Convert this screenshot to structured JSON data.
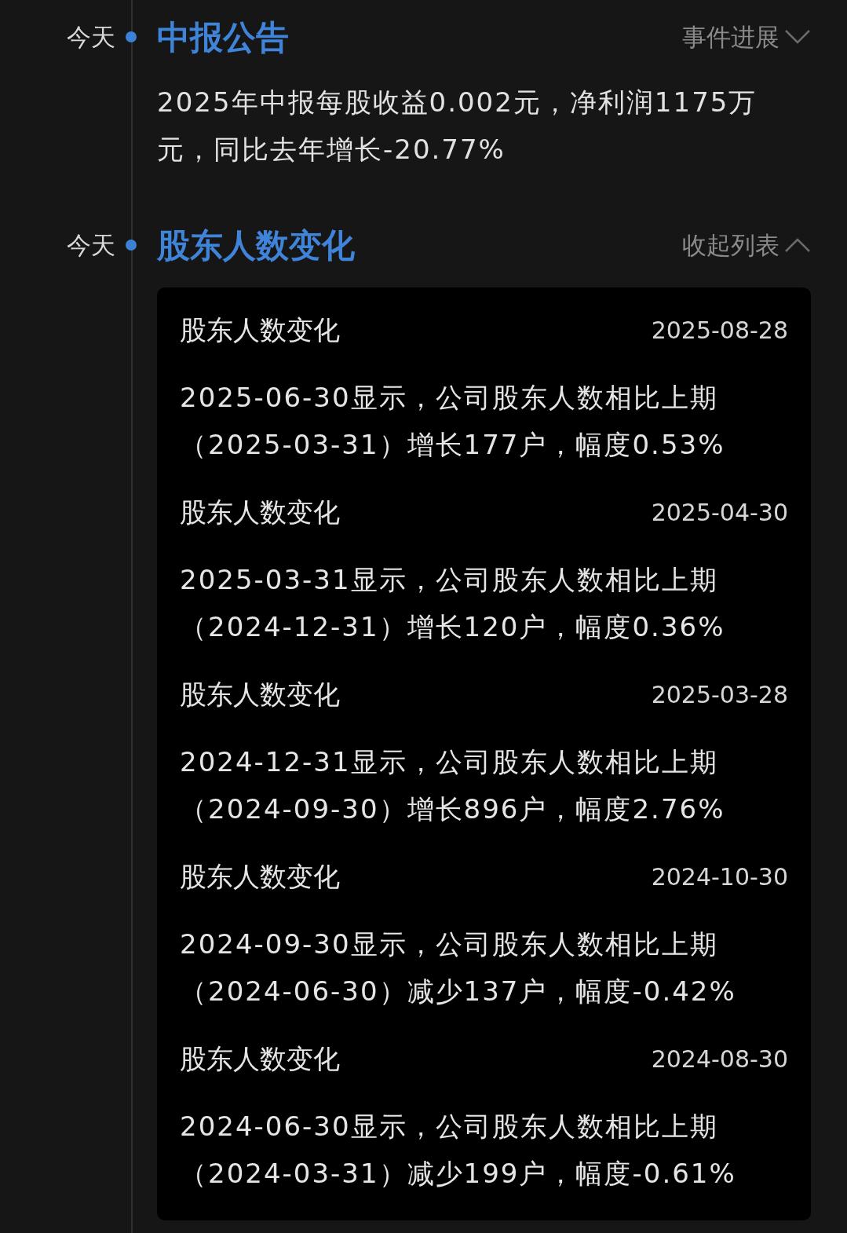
{
  "events": [
    {
      "time": "今天",
      "title": "中报公告",
      "toggle": {
        "label": "事件进展",
        "expanded": false
      },
      "body": "2025年中报每股收益0.002元，净利润1175万元，同比去年增长-20.77%"
    },
    {
      "time": "今天",
      "title": "股东人数变化",
      "toggle": {
        "label": "收起列表",
        "expanded": true
      },
      "records": [
        {
          "title": "股东人数变化",
          "date": "2025-08-28",
          "text": "2025-06-30显示，公司股东人数相比上期（2025-03-31）增长177户，幅度0.53%"
        },
        {
          "title": "股东人数变化",
          "date": "2025-04-30",
          "text": "2025-03-31显示，公司股东人数相比上期（2024-12-31）增长120户，幅度0.36%"
        },
        {
          "title": "股东人数变化",
          "date": "2025-03-28",
          "text": "2024-12-31显示，公司股东人数相比上期（2024-09-30）增长896户，幅度2.76%"
        },
        {
          "title": "股东人数变化",
          "date": "2024-10-30",
          "text": "2024-09-30显示，公司股东人数相比上期（2024-06-30）减少137户，幅度-0.42%"
        },
        {
          "title": "股东人数变化",
          "date": "2024-08-30",
          "text": "2024-06-30显示，公司股东人数相比上期（2024-03-31）减少199户，幅度-0.61%"
        }
      ]
    }
  ]
}
